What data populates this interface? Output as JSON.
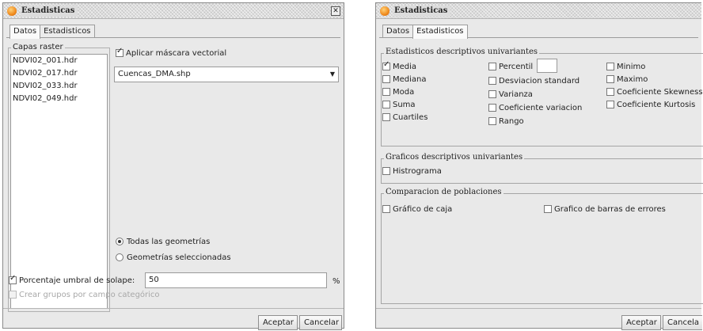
{
  "left_dialog": {
    "title": "Estadisticas",
    "close": "✕",
    "tabs": [
      "Datos",
      "Estadisticos"
    ],
    "raster_group_label": "Capas raster",
    "raster_layers": [
      "NDVI02_001.hdr",
      "NDVI02_017.hdr",
      "NDVI02_033.hdr",
      "NDVI02_049.hdr"
    ],
    "apply_mask_label": "Aplicar máscara vectorial",
    "vector_mask_value": "Cuencas_DMA.shp",
    "radio_all": "Todas las geometrías",
    "radio_selected": "Geometrías seleccionadas",
    "overlap_label": "Porcentaje umbral de solape:",
    "overlap_value": "50",
    "overlap_unit": "%",
    "groups_label": "Crear grupos por campo categórico",
    "accept": "Aceptar",
    "cancel": "Cancelar"
  },
  "right_dialog": {
    "title": "Estadisticas",
    "tabs": [
      "Datos",
      "Estadisticos"
    ],
    "section_univariate": "Estadisticos descriptivos univariantes",
    "col1": [
      "Media",
      "Mediana",
      "Moda",
      "Suma",
      "Cuartiles"
    ],
    "col2": [
      "Percentil",
      "Desviacion standard",
      "Varianza",
      "Coeficiente variacion",
      "Rango"
    ],
    "col3": [
      "Minimo",
      "Maximo",
      "Coeficiente Skewness",
      "Coeficiente Kurtosis"
    ],
    "percentile_value": "",
    "section_graphics": "Graficos descriptivos univariantes",
    "histogram": "Histrograma",
    "section_comparison": "Comparacion de poblaciones",
    "boxplot": "Gráfico de caja",
    "errorbars": "Grafico de barras de errores",
    "accept": "Aceptar",
    "cancel": "Cancela"
  }
}
